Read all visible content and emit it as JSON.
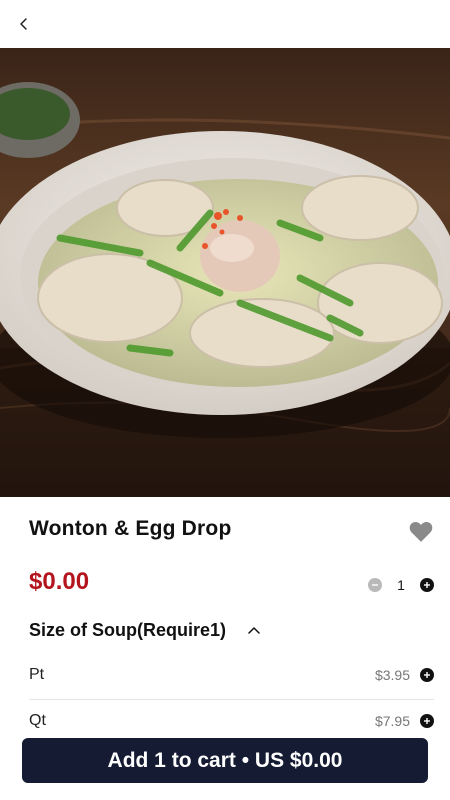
{
  "header": {
    "back_icon": "chevron-left-icon"
  },
  "product": {
    "name": "Wonton & Egg Drop",
    "price": "$0.00",
    "quantity": "1",
    "favorite_icon": "heart-icon"
  },
  "size_section": {
    "title": "Size of Soup(Require1)",
    "options": [
      {
        "name": "Pt",
        "price": "$3.95"
      },
      {
        "name": "Qt",
        "price": "$7.95"
      }
    ]
  },
  "cart": {
    "button_label": "Add 1 to cart • US $0.00"
  },
  "colors": {
    "price": "#b3141d",
    "cta": "#141b32"
  }
}
